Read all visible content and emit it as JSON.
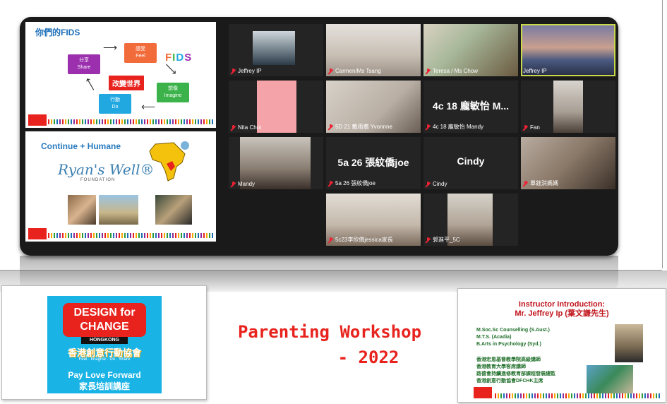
{
  "slide1": {
    "title": "你們的FIDS",
    "nodes": [
      {
        "cn": "感受",
        "en": "Feel",
        "color": "#f26b3a"
      },
      {
        "cn": "想像",
        "en": "Imagine",
        "color": "#3cb34a"
      },
      {
        "cn": "行動",
        "en": "Do",
        "color": "#21a8e1"
      },
      {
        "cn": "分享",
        "en": "Share",
        "color": "#9b2fae"
      }
    ],
    "center": "改變世界",
    "fids": [
      "F",
      "I",
      "D",
      "S"
    ],
    "fids_colors": [
      "#f26b3a",
      "#3cb34a",
      "#21a8e1",
      "#9b2fae"
    ]
  },
  "slide2": {
    "title": "Continue + Humane",
    "brand": "Ryan's Well®",
    "brand_sub": "FOUNDATION"
  },
  "participants": [
    {
      "name": "Jeffrey IP",
      "muted": true
    },
    {
      "name": "Carmen/Ms Tsang",
      "muted": true
    },
    {
      "name": "Teresa / Ms Chow",
      "muted": true
    },
    {
      "name": "Jeffrey IP",
      "muted": false,
      "active": true
    },
    {
      "name": "Nita Choi",
      "muted": true
    },
    {
      "name": "5D 21 戴雨蕎 Yvonnne",
      "muted": true
    },
    {
      "name": "4c 18 龐敏怡 Mandy",
      "muted": true,
      "display": "4c 18 龐敏怡 M..."
    },
    {
      "name": "Fan",
      "muted": true
    },
    {
      "name": "Mandy",
      "muted": true
    },
    {
      "name": "5a 26 張紋僑joe",
      "muted": true,
      "display": "5a 26 張紋僑joe"
    },
    {
      "name": "Cindy",
      "muted": true,
      "display": "Cindy"
    },
    {
      "name": "單鈺淇媽媽",
      "muted": true
    },
    {
      "name": "5c23李欣僑jessica家長",
      "muted": true
    },
    {
      "name": "郭進平_5C",
      "muted": true
    }
  ],
  "left_slide": {
    "line1": "DESIGN for",
    "line2": "CHANGE",
    "hk": "HONGKONG",
    "cn": "香港創意行動協會",
    "small": "Feel · Imagine · Do · Share",
    "pay": "Pay Love Forward",
    "cn2": "家長培訓講座"
  },
  "workshop": {
    "line1": "Parenting Workshop",
    "line2": "- 2022"
  },
  "right_slide": {
    "title1": "Instructor Introduction:",
    "title2": "Mr. Jeffrey Ip (葉文謙先生)",
    "quals": [
      "M.Soc.Sc Counselling (S.Aust.)",
      "M.T.S. (Acadia)",
      "B.Arts in Psychology (Syd.)"
    ],
    "roles": [
      "香港宏恩基督教學院高級講師",
      "香港教育大學客席講師",
      "路德會持續進修教育部課程發展總監",
      "香港創意行動協會DFCHK主席"
    ]
  }
}
